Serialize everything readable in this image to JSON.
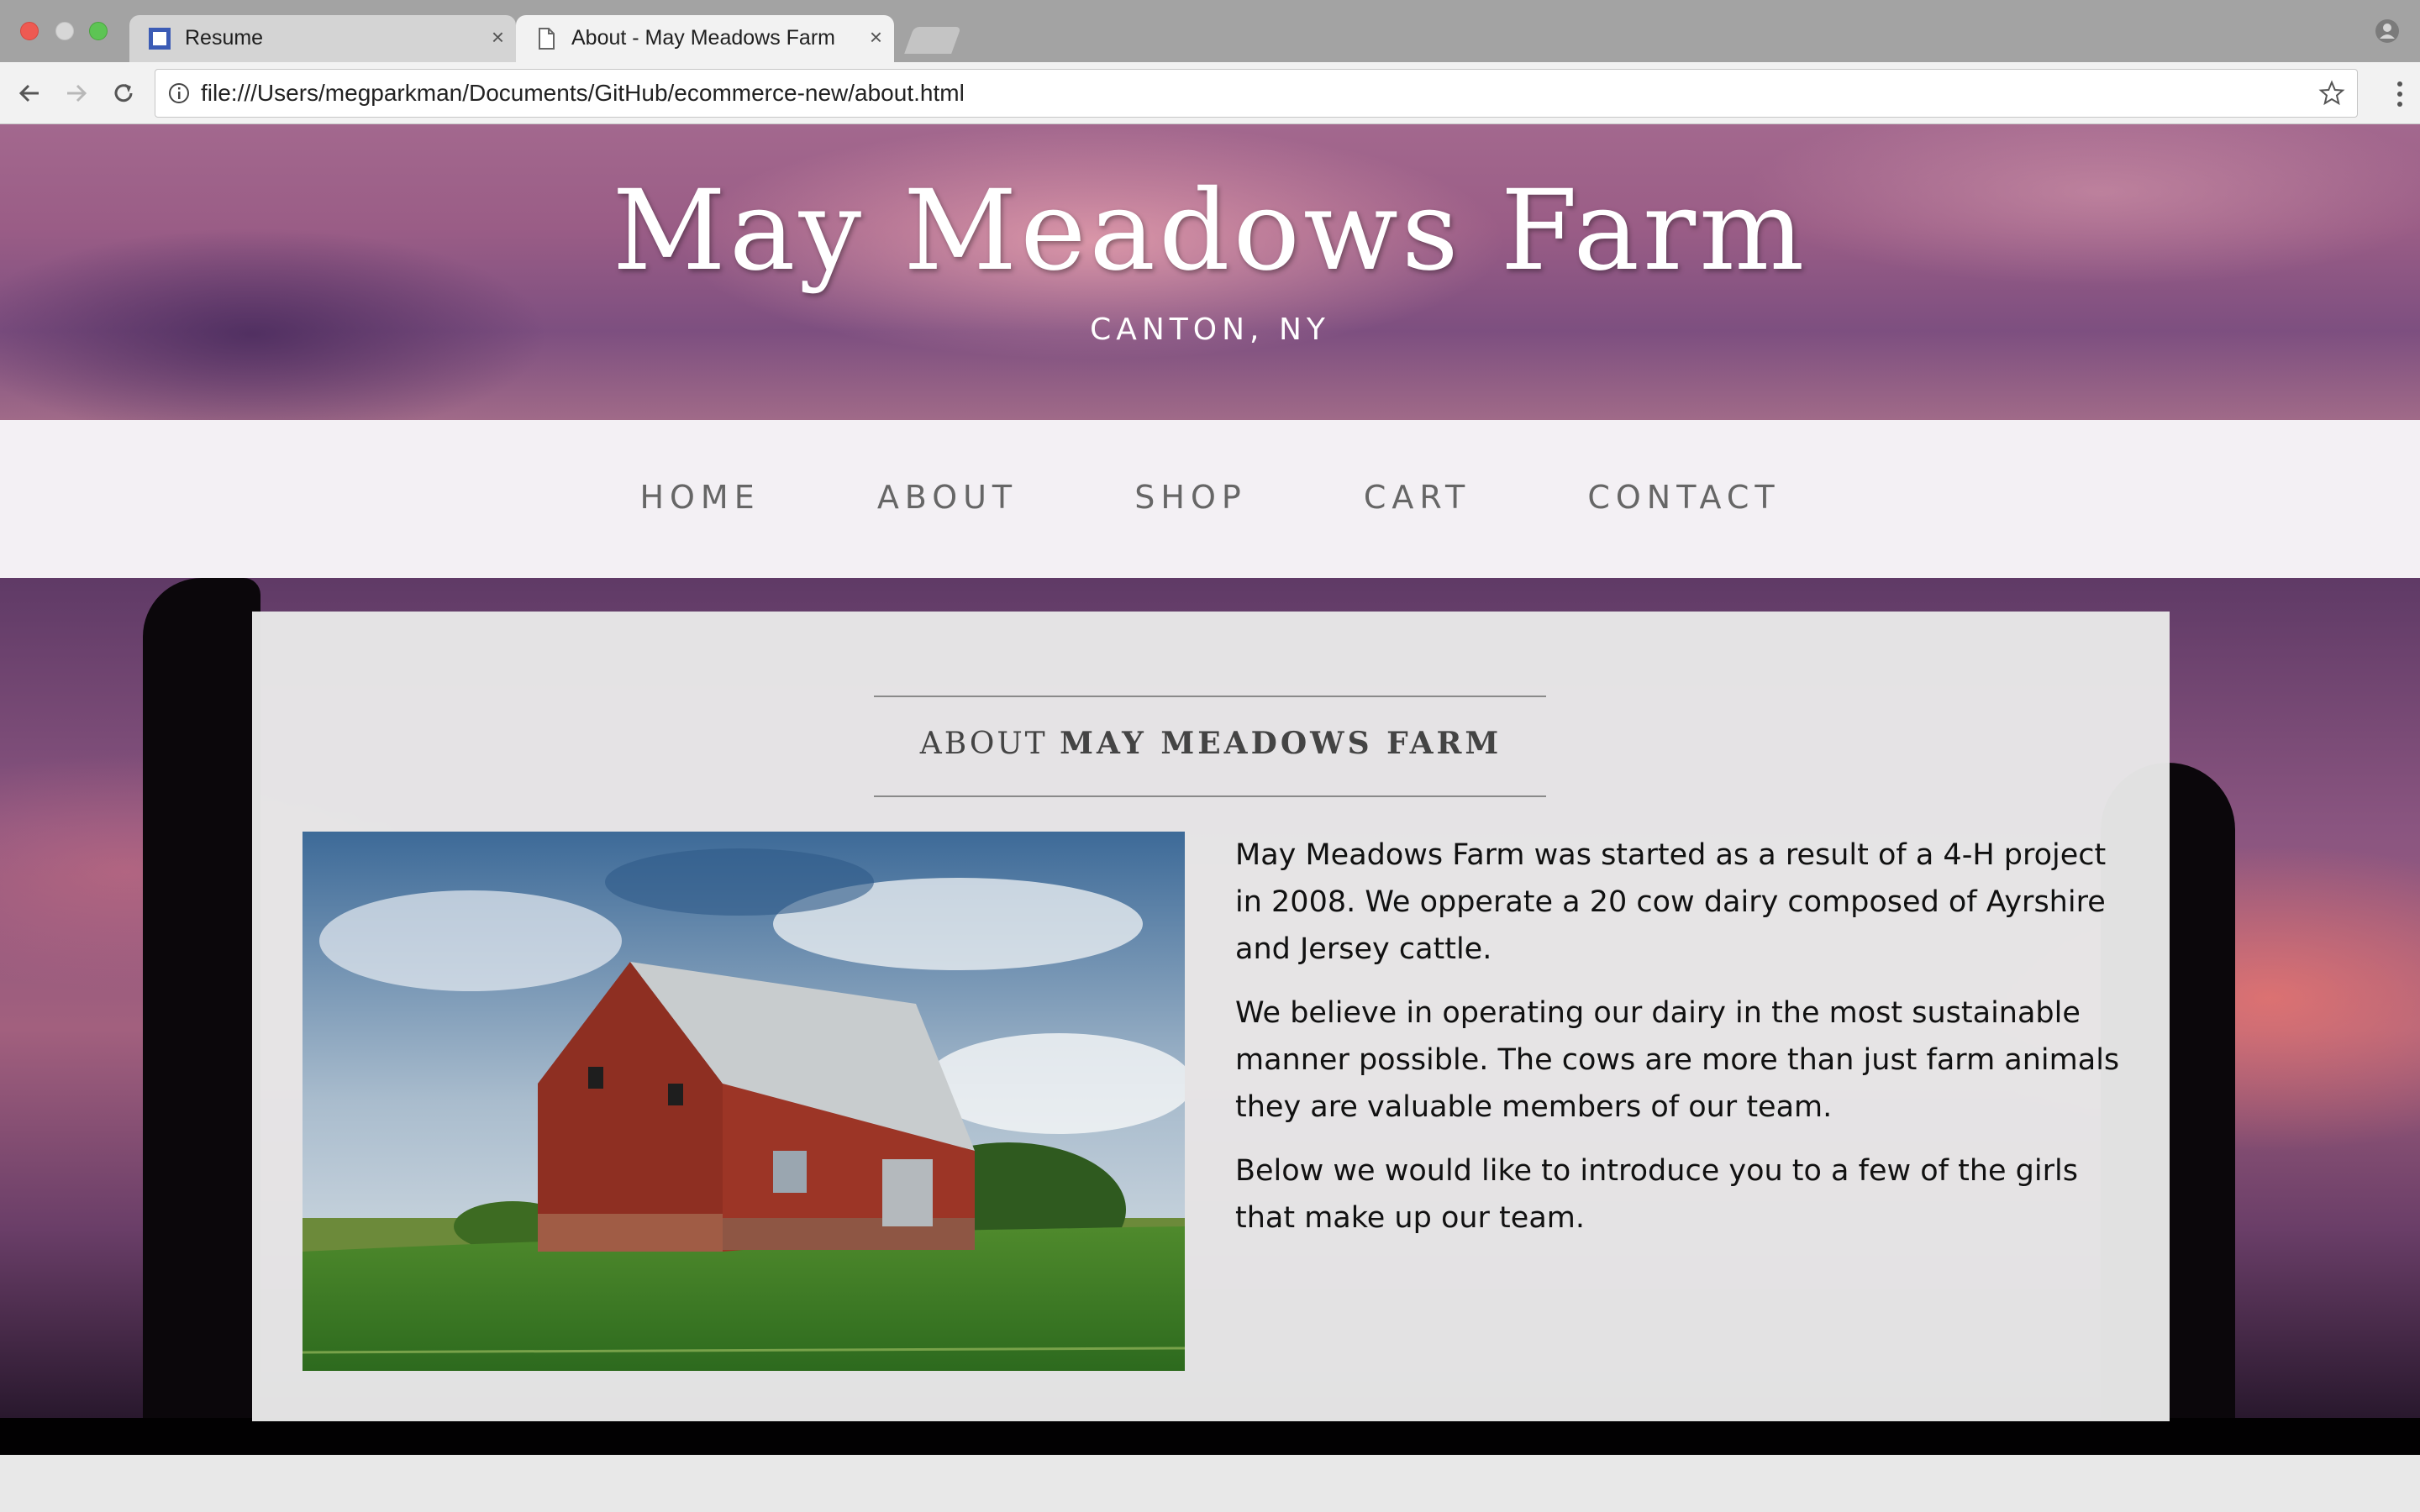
{
  "browser": {
    "tabs": [
      {
        "title": "Resume",
        "active": false
      },
      {
        "title": "About - May Meadows Farm",
        "active": true
      }
    ],
    "close_glyph": "×",
    "url": "file:///Users/megparkman/Documents/GitHub/ecommerce-new/about.html",
    "icons": [
      "back-arrow-icon",
      "forward-arrow-icon",
      "reload-icon",
      "info-icon",
      "bookmark-star-icon",
      "menu-dots-icon",
      "profile-icon"
    ]
  },
  "site": {
    "title": "May Meadows Farm",
    "subtitle": "CANTON, NY"
  },
  "nav": {
    "items": [
      "HOME",
      "ABOUT",
      "SHOP",
      "CART",
      "CONTACT"
    ]
  },
  "about": {
    "heading_prefix": "ABOUT",
    "heading_name": "MAY MEADOWS FARM",
    "paragraphs": [
      "May Meadows Farm was started as a result of a 4-H project in 2008. We opperate a 20 cow dairy composed of Ayrshire and Jersey cattle.",
      "We believe in operating our dairy in the most sustainable manner possible. The cows are more than just farm animals they are valuable members of our team.",
      "Below we would like to introduce you to a few of the girls that make up our team."
    ]
  },
  "colors": {
    "accent_hero": "#9a5d86",
    "nav_text": "#666666",
    "panel_bg": "#e8e8e8"
  }
}
